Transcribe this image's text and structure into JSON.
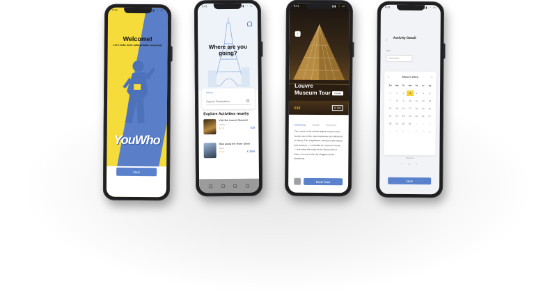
{
  "colors": {
    "accent_blue": "#5a82cc",
    "brand_yellow": "#f5dc3a",
    "highlight_yellow": "#f5d23a"
  },
  "phone1": {
    "title": "Welcome!",
    "subtitle": "Let's make some unforgettable memories!",
    "brand": "YouWho",
    "next_label": "Next"
  },
  "phone2": {
    "title": "Where are you going?",
    "search_label": "Where",
    "search_placeholder": "Search Destination",
    "section_title": "Explore Activities nearby",
    "activities": [
      {
        "name": "Visit the Louvre Museum",
        "meta": "Culture",
        "rating": "★ 4.8",
        "price": "€15"
      },
      {
        "name": "Bike along the River Seine",
        "meta": "Sport",
        "rating": "★ 4.6",
        "price": "€ 25hr"
      }
    ],
    "nav_icons": [
      "home-icon",
      "explore-icon",
      "bookings-icon",
      "profile-icon"
    ]
  },
  "phone3": {
    "back": "‹",
    "title_line1": "Louvre",
    "title_line2": "Museum Tour",
    "badge": "Culture",
    "price": "€15",
    "duration": "1h 30m",
    "tabs": [
      "Overview",
      "Guide",
      "Reviews"
    ],
    "description": "The Louvre is the world's largest museum and houses one of the most impressive art collections in history. This magnificent, baroque-style palace and museum — Le Musée du Louvre in French — sits along the banks of the Seine River in Paris. It is one of the city's biggest tourist attractions.",
    "book_label": "Book Now"
  },
  "phone4": {
    "back": "‹",
    "title": "Activity Detail",
    "date_label": "Date",
    "date_value": "06/05/2021",
    "month": "March 2021",
    "weekdays": [
      "Su",
      "Mo",
      "Tu",
      "We",
      "Th",
      "Fr",
      "Sa"
    ],
    "selected_day": "3",
    "travelers_label": "Travelers",
    "stepper_minus": "−",
    "stepper_value": "1",
    "stepper_plus": "+",
    "next_label": "Next"
  }
}
